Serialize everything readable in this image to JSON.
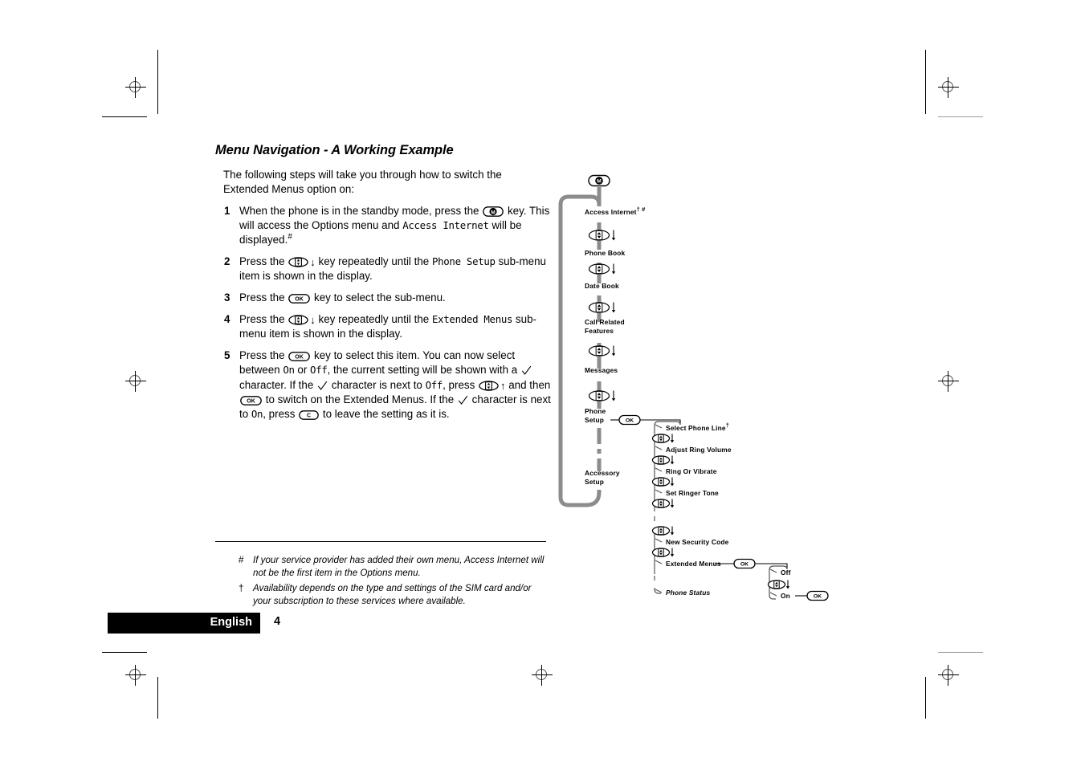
{
  "page": {
    "heading": "Menu Navigation - A Working Example",
    "intro": "The following steps will take you through how to switch the Extended Menus option on:",
    "language_label": "English",
    "page_number": "4"
  },
  "steps": [
    {
      "num": "1",
      "parts": [
        {
          "t": "text",
          "v": "When the phone is in the standby mode, press the "
        },
        {
          "t": "key",
          "v": "M"
        },
        {
          "t": "text",
          "v": " key. This will access the Options menu and "
        },
        {
          "t": "lcd",
          "v": "Access Internet"
        },
        {
          "t": "text",
          "v": " will be displayed."
        },
        {
          "t": "sup",
          "v": "#"
        }
      ]
    },
    {
      "num": "2",
      "parts": [
        {
          "t": "text",
          "v": "Press the "
        },
        {
          "t": "key",
          "v": "rocker"
        },
        {
          "t": "arrow",
          "v": "↓"
        },
        {
          "t": "text",
          "v": " key repeatedly until the "
        },
        {
          "t": "lcd",
          "v": "Phone Setup"
        },
        {
          "t": "text",
          "v": " sub-menu item is shown in the display."
        }
      ]
    },
    {
      "num": "3",
      "parts": [
        {
          "t": "text",
          "v": "Press the "
        },
        {
          "t": "key",
          "v": "OK"
        },
        {
          "t": "text",
          "v": " key to select the sub-menu."
        }
      ]
    },
    {
      "num": "4",
      "parts": [
        {
          "t": "text",
          "v": "Press the "
        },
        {
          "t": "key",
          "v": "rocker"
        },
        {
          "t": "arrow",
          "v": "↓"
        },
        {
          "t": "text",
          "v": " key repeatedly until the "
        },
        {
          "t": "lcd",
          "v": "Extended Menus"
        },
        {
          "t": "text",
          "v": " sub-menu item is shown in the display."
        }
      ]
    },
    {
      "num": "5",
      "parts": [
        {
          "t": "text",
          "v": "Press the "
        },
        {
          "t": "key",
          "v": "OK"
        },
        {
          "t": "text",
          "v": " key to select this item. You can now select between "
        },
        {
          "t": "lcd",
          "v": "On"
        },
        {
          "t": "text",
          "v": " or "
        },
        {
          "t": "lcd",
          "v": "Off"
        },
        {
          "t": "text",
          "v": ", the current setting will be shown with a "
        },
        {
          "t": "check",
          "v": "✓"
        },
        {
          "t": "text",
          "v": " character. If the "
        },
        {
          "t": "check",
          "v": "✓"
        },
        {
          "t": "text",
          "v": " character is next to "
        },
        {
          "t": "lcd",
          "v": "Off"
        },
        {
          "t": "text",
          "v": ", press "
        },
        {
          "t": "key",
          "v": "rocker"
        },
        {
          "t": "arrow",
          "v": "↑"
        },
        {
          "t": "text",
          "v": " and then "
        },
        {
          "t": "key",
          "v": "OK"
        },
        {
          "t": "text",
          "v": " to switch on the Extended Menus. If the "
        },
        {
          "t": "check",
          "v": "✓"
        },
        {
          "t": "text",
          "v": " character is next to "
        },
        {
          "t": "lcd",
          "v": "On"
        },
        {
          "t": "text",
          "v": ", press "
        },
        {
          "t": "key",
          "v": "C"
        },
        {
          "t": "text",
          "v": " to leave the setting as it is."
        }
      ]
    }
  ],
  "footnotes": [
    {
      "marker": "#",
      "text": "If your service provider has added their own menu, Access Internet will not be the first item in the Options menu."
    },
    {
      "marker": "†",
      "text": "Availability depends on the type and settings of the SIM card and/or your subscription to these services where available."
    }
  ],
  "diagram": {
    "entry_key": "M",
    "main_menu": [
      {
        "label": "Access Internet",
        "marks": "† #"
      },
      {
        "label": "Phone Book",
        "marks": ""
      },
      {
        "label": "Date Book",
        "marks": ""
      },
      {
        "label": "Call Related\nFeatures",
        "marks": ""
      },
      {
        "label": "Messages",
        "marks": ""
      },
      {
        "label": "Phone\nSetup",
        "marks": ""
      },
      {
        "label": "Accessory\nSetup",
        "marks": ""
      }
    ],
    "branch_key": "OK",
    "sub_menu": [
      {
        "label": "Select Phone Line",
        "marks": "†",
        "italic": false
      },
      {
        "label": "Adjust Ring Volume",
        "marks": "",
        "italic": false
      },
      {
        "label": "Ring Or Vibrate",
        "marks": "",
        "italic": false
      },
      {
        "label": "Set Ringer Tone",
        "marks": "",
        "italic": false
      },
      {
        "label": "New Security Code",
        "marks": "",
        "italic": false
      },
      {
        "label": "Extended Menus",
        "marks": "",
        "italic": false
      },
      {
        "label": "Phone Status",
        "marks": "",
        "italic": true
      }
    ],
    "leaf_key": "OK",
    "leaf_options": [
      {
        "label": "Off",
        "has_ok": false
      },
      {
        "label": "On",
        "has_ok": true
      }
    ],
    "leaf_confirm_key": "OK",
    "nav_key": "rocker",
    "nav_arrow": "↓",
    "colors": {
      "flow_line": "#8c8c8c",
      "branch_line": "#555555",
      "text": "#000000"
    }
  }
}
